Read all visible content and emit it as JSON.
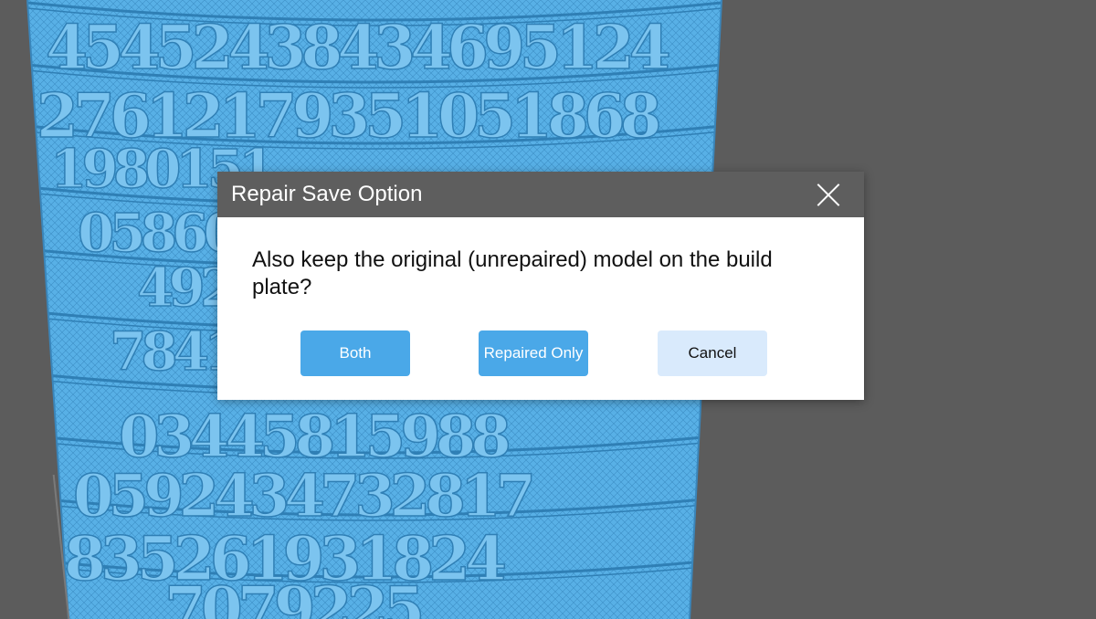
{
  "dialog": {
    "title": "Repair Save Option",
    "message": "Also keep the original (unrepaired) model on the build plate?",
    "buttons": {
      "both": "Both",
      "repaired_only": "Repaired Only",
      "cancel": "Cancel"
    }
  },
  "viewport": {
    "model_digits": [
      "45452438434695124",
      "27612179351051868",
      "1980151",
      "05860",
      "492",
      "7841",
      "03445815988",
      "0592434732817",
      "835261931824",
      "7079225"
    ],
    "colors": {
      "background": "#5c5c5c",
      "model": "#58b0e6",
      "model_dark": "#2f7fb5",
      "dialog_titlebar": "#5e5e5e",
      "primary_button": "#4aa8e8",
      "secondary_button": "#d9eafc"
    }
  }
}
